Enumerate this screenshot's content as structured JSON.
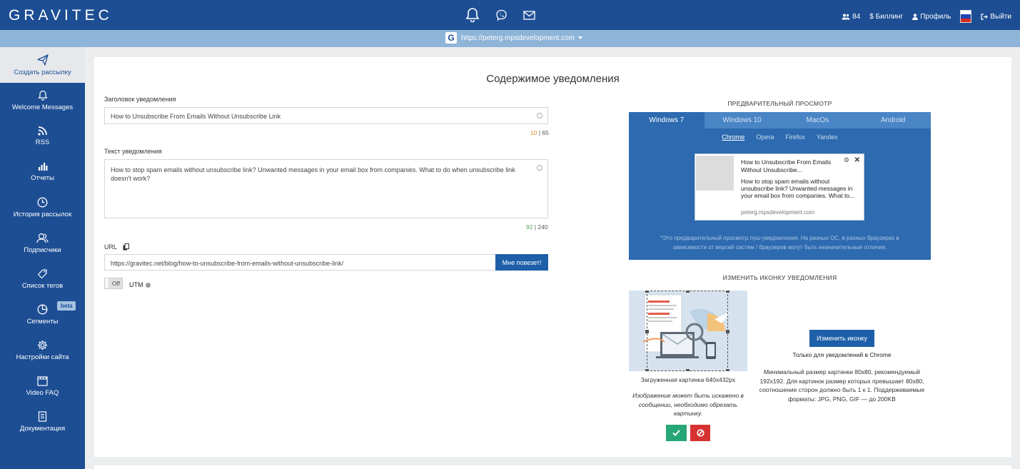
{
  "header": {
    "logo": "GRAVITEC",
    "center_icons": [
      "bell-icon",
      "viber-icon",
      "mail-icon"
    ],
    "subscribers_count": "84",
    "billing_label": "$ Биллинг",
    "profile_label": "Профиль",
    "logout_label": "Выйти",
    "language": "russian-flag-icon"
  },
  "site_selector": {
    "url": "https://peterg.mpsdevelopment.com"
  },
  "sidebar": {
    "items": [
      {
        "label": "Создать рассылку",
        "icon": "send-icon"
      },
      {
        "label": "Welcome Messages",
        "icon": "bell-icon"
      },
      {
        "label": "RSS",
        "icon": "rss-icon"
      },
      {
        "label": "Отчеты",
        "icon": "bar-chart-icon"
      },
      {
        "label": "История рассылок",
        "icon": "clock-icon"
      },
      {
        "label": "Подписчики",
        "icon": "users-icon"
      },
      {
        "label": "Список тегов",
        "icon": "tag-icon"
      },
      {
        "label": "Сегменты",
        "icon": "pie-chart-icon",
        "badge": "beta"
      },
      {
        "label": "Настройки сайта",
        "icon": "gear-icon"
      },
      {
        "label": "Video FAQ",
        "icon": "video-icon"
      },
      {
        "label": "Документация",
        "icon": "document-icon"
      }
    ]
  },
  "main": {
    "title": "Содержимое уведомления",
    "title_field": {
      "label": "Заголовок уведомления",
      "value": "How to Unsubscribe From Emails Without Unsubscribe Link",
      "count": "10",
      "max": "65"
    },
    "text_field": {
      "label": "Текст уведомления",
      "value": "How to stop spam emails without unsubscribe link? Unwanted messages in your email box from companies. What to do when unsubscribe link doesn't work?",
      "count": "92",
      "max": "240"
    },
    "url_field": {
      "label": "URL",
      "value": "https://gravitec.net/blog/how-to-unsubscribe-from-emails-without-unsubscribe-link/",
      "button": "Мне повезет!"
    },
    "utm": {
      "toggle": "Off",
      "label": "UTM"
    }
  },
  "preview": {
    "title": "ПРЕДВАРИТЕЛЬНЫЙ ПРОСМОТР",
    "os_tabs": [
      "Windows 7",
      "Windows 10",
      "MacOs",
      "Android"
    ],
    "browser_tabs": [
      "Chrome",
      "Opera",
      "Firefox",
      "Yandex"
    ],
    "notification": {
      "title": "How to Unsubscribe From Emails Without Unsubscribe...",
      "body": "How to stop spam emails without unsubscribe link? Unwanted messages in your email box from companies. What to...",
      "site": "peterg.mpsdevelopment.com"
    },
    "note": "*Это предварительный просмотр пуш-уведомления. На разных ОС, в разных браузерах в зависимости от версий систем / браузеров могут быть незначительные отличия."
  },
  "icon_section": {
    "title": "ИЗМЕНИТЬ ИКОНКУ УВЕДОМЛЕНИЯ",
    "uploaded_caption": "Загруженная картинка 640x432px",
    "warning": "Изображение может быть искажено в сообщении, необходимо обрезать картинку.",
    "change_button": "Изменить иконку",
    "chrome_only": "Только для уведомлений в Chrome",
    "requirements": "Минимальный размер картинки 80x80, рекомендуемый 192x192. Для картинок размер которых превышает 80x80, соотношение сторон должно быть 1 к 1. Поддерживаемые форматы: JPG, PNG, GIF — до 200KB"
  },
  "colors": {
    "brand": "#1d4e94",
    "accent_button": "#1d5fa8",
    "confirm": "#27a776",
    "cancel": "#d63232"
  }
}
